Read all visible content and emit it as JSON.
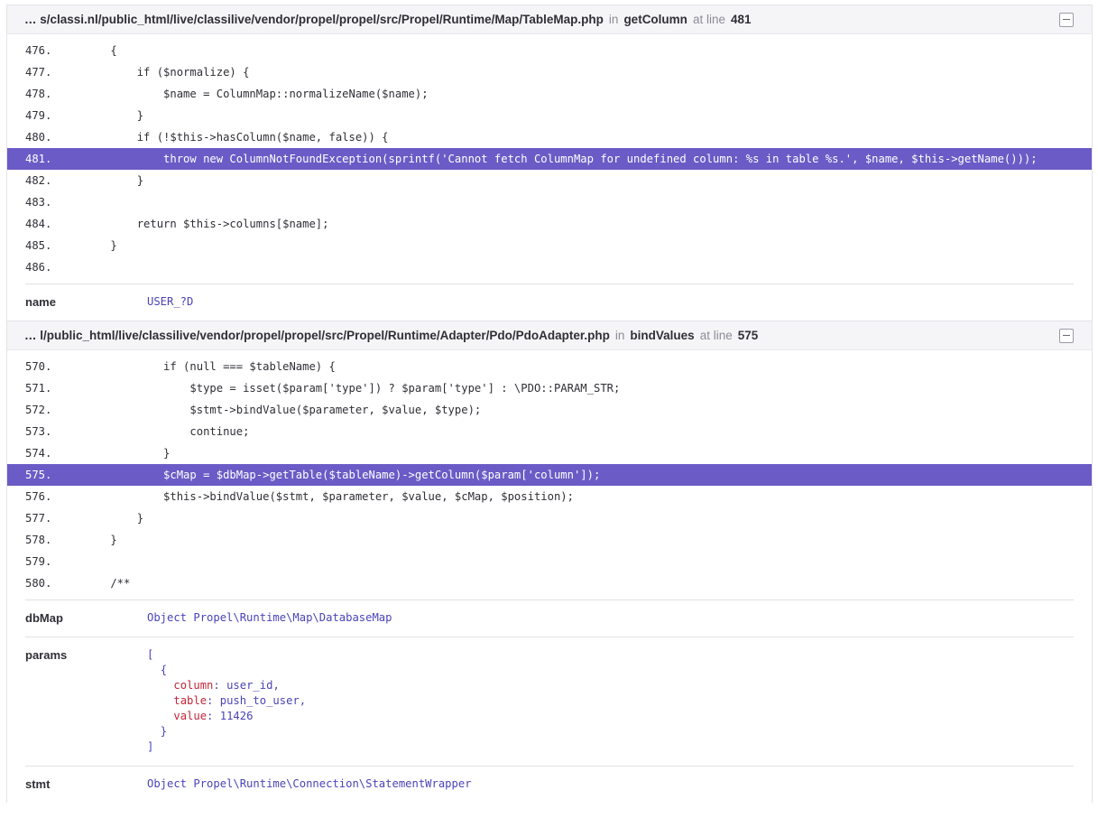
{
  "frames": [
    {
      "path": "… s/classi.nl/public_html/live/classilive/vendor/propel/propel/src/Propel/Runtime/Map/TableMap.php",
      "in_label": "in",
      "function": "getColumn",
      "at_line_label": "at line",
      "line": "481",
      "code": [
        {
          "ln": "476.",
          "src": "    {"
        },
        {
          "ln": "477.",
          "src": "        if ($normalize) {"
        },
        {
          "ln": "478.",
          "src": "            $name = ColumnMap::normalizeName($name);"
        },
        {
          "ln": "479.",
          "src": "        }"
        },
        {
          "ln": "480.",
          "src": "        if (!$this->hasColumn($name, false)) {"
        },
        {
          "ln": "481.",
          "src": "            throw new ColumnNotFoundException(sprintf('Cannot fetch ColumnMap for undefined column: %s in table %s.', $name, $this->getName()));"
        },
        {
          "ln": "482.",
          "src": "        }"
        },
        {
          "ln": "483.",
          "src": ""
        },
        {
          "ln": "484.",
          "src": "        return $this->columns[$name];"
        },
        {
          "ln": "485.",
          "src": "    }"
        },
        {
          "ln": "486.",
          "src": ""
        }
      ],
      "active_index": 5,
      "vars": [
        {
          "name": "name",
          "value": "USER_?D"
        }
      ]
    },
    {
      "path": "… l/public_html/live/classilive/vendor/propel/propel/src/Propel/Runtime/Adapter/Pdo/PdoAdapter.php",
      "in_label": "in",
      "function": "bindValues",
      "at_line_label": "at line",
      "line": "575",
      "code": [
        {
          "ln": "570.",
          "src": "            if (null === $tableName) {"
        },
        {
          "ln": "571.",
          "src": "                $type = isset($param['type']) ? $param['type'] : \\PDO::PARAM_STR;"
        },
        {
          "ln": "572.",
          "src": "                $stmt->bindValue($parameter, $value, $type);"
        },
        {
          "ln": "573.",
          "src": "                continue;"
        },
        {
          "ln": "574.",
          "src": "            }"
        },
        {
          "ln": "575.",
          "src": "            $cMap = $dbMap->getTable($tableName)->getColumn($param['column']);"
        },
        {
          "ln": "576.",
          "src": "            $this->bindValue($stmt, $parameter, $value, $cMap, $position);"
        },
        {
          "ln": "577.",
          "src": "        }"
        },
        {
          "ln": "578.",
          "src": "    }"
        },
        {
          "ln": "579.",
          "src": ""
        },
        {
          "ln": "580.",
          "src": "    /**"
        }
      ],
      "active_index": 5,
      "vars": [
        {
          "name": "dbMap",
          "value": "Object Propel\\Runtime\\Map\\DatabaseMap"
        },
        {
          "name": "params",
          "open_bracket": "[",
          "open_brace": "{",
          "entries": [
            {
              "key": "column",
              "value": "user_id",
              "sep": ","
            },
            {
              "key": "table",
              "value": "push_to_user",
              "sep": ","
            },
            {
              "key": "value",
              "value": "11426",
              "sep": ""
            }
          ],
          "close_brace": "}",
          "close_bracket": "]"
        },
        {
          "name": "stmt",
          "value": "Object Propel\\Runtime\\Connection\\StatementWrapper"
        }
      ]
    }
  ],
  "colors": {
    "active_line_bg": "#6a5bc6",
    "header_bg": "#f5f5f8",
    "var_value": "#4a44b8",
    "var_key": "#c2263a"
  },
  "icons": {
    "collapse": "collapse-icon"
  }
}
